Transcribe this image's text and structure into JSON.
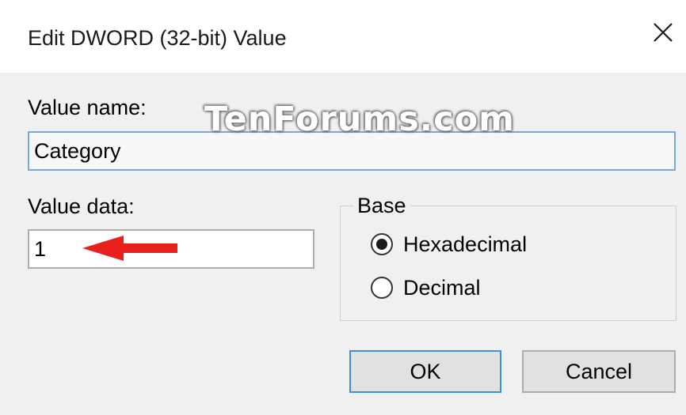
{
  "dialog": {
    "title": "Edit DWORD (32-bit) Value",
    "close_icon": "close-icon"
  },
  "watermark": "TenForums.com",
  "value_name": {
    "label": "Value name:",
    "value": "Category"
  },
  "value_data": {
    "label": "Value data:",
    "value": "1"
  },
  "base": {
    "title": "Base",
    "options": [
      {
        "label": "Hexadecimal",
        "selected": true
      },
      {
        "label": "Decimal",
        "selected": false
      }
    ]
  },
  "buttons": {
    "ok_label": "OK",
    "cancel_label": "Cancel"
  },
  "colors": {
    "annotation_arrow": "#e8201a",
    "focus_border": "#3c8ee0"
  }
}
